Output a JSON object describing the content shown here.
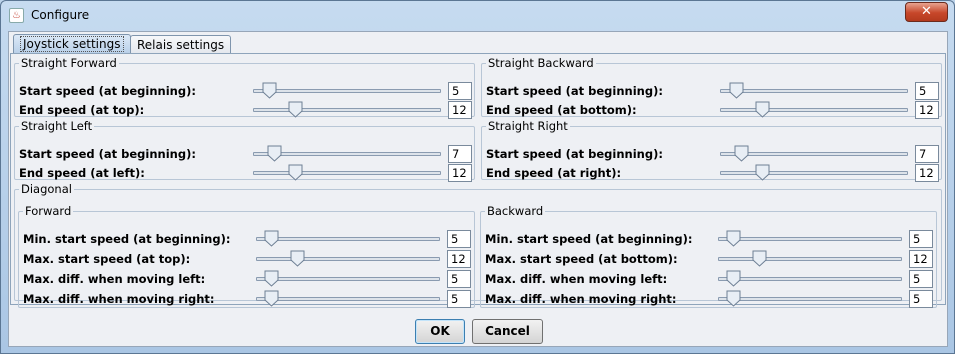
{
  "window": {
    "title": "Configure",
    "icon": "java-icon",
    "close_label": "✕"
  },
  "tabs": [
    {
      "label": "Joystick settings",
      "active": true
    },
    {
      "label": "Relais settings",
      "active": false
    }
  ],
  "groups": {
    "straight_forward": {
      "title": "Straight Forward",
      "rows": [
        {
          "label": "Start speed (at beginning):",
          "value": "5",
          "level": 0.05
        },
        {
          "label": "End speed (at top):",
          "value": "12",
          "level": 0.2
        }
      ]
    },
    "straight_backward": {
      "title": "Straight Backward",
      "rows": [
        {
          "label": "Start speed (at beginning):",
          "value": "5",
          "level": 0.05
        },
        {
          "label": "End speed (at bottom):",
          "value": "12",
          "level": 0.2
        }
      ]
    },
    "straight_left": {
      "title": "Straight Left",
      "rows": [
        {
          "label": "Start speed (at beginning):",
          "value": "7",
          "level": 0.08
        },
        {
          "label": "End speed (at left):",
          "value": "12",
          "level": 0.2
        }
      ]
    },
    "straight_right": {
      "title": "Straight Right",
      "rows": [
        {
          "label": "Start speed (at beginning):",
          "value": "7",
          "level": 0.08
        },
        {
          "label": "End speed (at right):",
          "value": "12",
          "level": 0.2
        }
      ]
    },
    "diagonal": {
      "title": "Diagonal",
      "forward": {
        "title": "Forward",
        "rows": [
          {
            "label": "Min. start speed (at beginning):",
            "value": "5",
            "level": 0.05
          },
          {
            "label": "Max. start speed (at top):",
            "value": "12",
            "level": 0.2
          },
          {
            "label": "Max. diff. when moving left:",
            "value": "5",
            "level": 0.05
          },
          {
            "label": "Max. diff. when moving right:",
            "value": "5",
            "level": 0.05
          }
        ]
      },
      "backward": {
        "title": "Backward",
        "rows": [
          {
            "label": "Min. start speed (at beginning):",
            "value": "5",
            "level": 0.05
          },
          {
            "label": "Max. start speed (at bottom):",
            "value": "12",
            "level": 0.2
          },
          {
            "label": "Max. diff. when moving left:",
            "value": "5",
            "level": 0.05
          },
          {
            "label": "Max. diff. when moving right:",
            "value": "5",
            "level": 0.05
          }
        ]
      }
    }
  },
  "buttons": {
    "ok": "OK",
    "cancel": "Cancel"
  }
}
